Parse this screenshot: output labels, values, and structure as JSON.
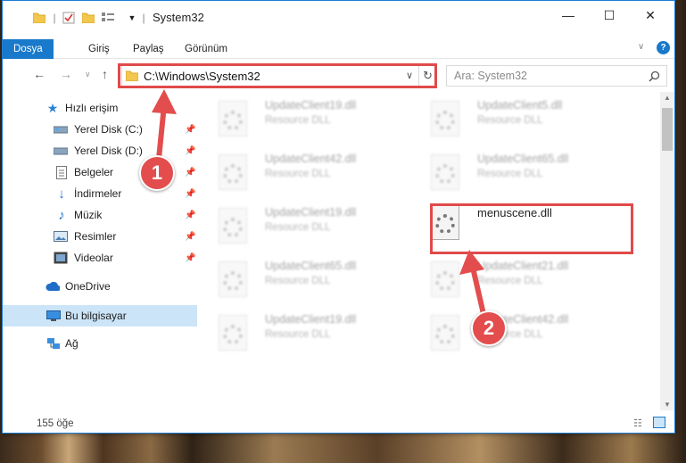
{
  "window": {
    "title": "System32",
    "minimize_icon": "minimize-icon",
    "maximize_icon": "maximize-icon",
    "close_icon": "close-icon"
  },
  "ribbon": {
    "tabs": [
      "Dosya",
      "Giriş",
      "Paylaş",
      "Görünüm"
    ]
  },
  "address": {
    "path": "C:\\Windows\\System32",
    "search_placeholder": "Ara: System32"
  },
  "sidebar": {
    "quick_access": "Hızlı erişim",
    "items": [
      {
        "label": "Yerel Disk (C:)",
        "icon": "drive-icon",
        "pinned": true
      },
      {
        "label": "Yerel Disk (D:)",
        "icon": "drive-icon",
        "pinned": true
      },
      {
        "label": "Belgeler",
        "icon": "documents-icon",
        "pinned": true
      },
      {
        "label": "İndirmeler",
        "icon": "downloads-icon",
        "pinned": true
      },
      {
        "label": "Müzik",
        "icon": "music-icon",
        "pinned": true
      },
      {
        "label": "Resimler",
        "icon": "pictures-icon",
        "pinned": true
      },
      {
        "label": "Videolar",
        "icon": "videos-icon",
        "pinned": true
      }
    ],
    "onedrive": "OneDrive",
    "this_pc": "Bu bilgisayar",
    "network": "Ağ"
  },
  "files": {
    "left": [
      {
        "name": "UpdateClient19.dll",
        "type": "Resource DLL"
      },
      {
        "name": "UpdateClient42.dll",
        "type": "Resource DLL"
      },
      {
        "name": "UpdateClient19.dll",
        "type": "Resource DLL"
      },
      {
        "name": "UpdateClient65.dll",
        "type": "Resource DLL"
      },
      {
        "name": "UpdateClient19.dll",
        "type": "Resource DLL"
      }
    ],
    "right": [
      {
        "name": "UpdateClient5.dll",
        "type": "Resource DLL"
      },
      {
        "name": "UpdateClient65.dll",
        "type": "Resource DLL"
      },
      {
        "name": "menuscene.dll",
        "type": ""
      },
      {
        "name": "UpdateClient21.dll",
        "type": "Resource DLL"
      },
      {
        "name": "UpdateClient42.dll",
        "type": "Resource DLL"
      }
    ]
  },
  "status": {
    "count": "155 öğe"
  },
  "annotations": {
    "step1": "1",
    "step2": "2",
    "color": "#e34d4d"
  }
}
